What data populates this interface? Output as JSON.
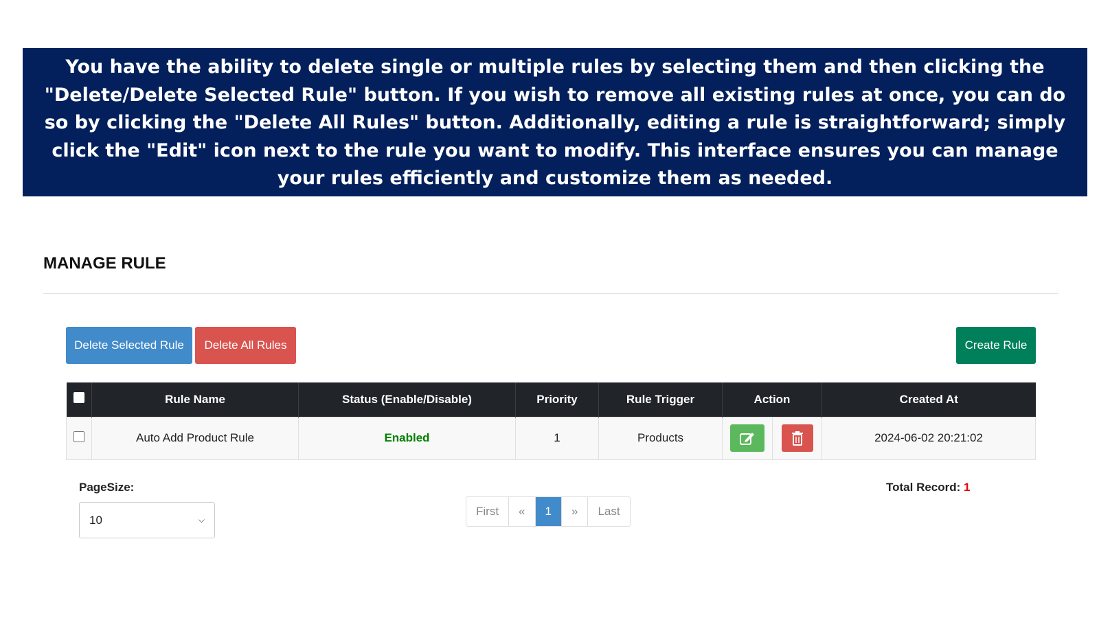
{
  "banner": {
    "text": "You have the ability to delete single or multiple rules by selecting them and then clicking the \"Delete/Delete Selected Rule\" button. If you wish to remove all existing rules at once, you can do so by clicking the \"Delete All Rules\" button. Additionally, editing a rule is straightforward; simply click the \"Edit\" icon next to the rule you want to modify. This interface ensures you can manage your rules efficiently and customize them as needed."
  },
  "page": {
    "title": "MANAGE RULE"
  },
  "toolbar": {
    "delete_selected": "Delete Selected Rule",
    "delete_all": "Delete All Rules",
    "create": "Create Rule"
  },
  "table": {
    "headers": [
      "Rule Name",
      "Status (Enable/Disable)",
      "Priority",
      "Rule Trigger",
      "Action",
      "Created At"
    ],
    "rows": [
      {
        "name": "Auto Add Product Rule",
        "status": "Enabled",
        "priority": "1",
        "trigger": "Products",
        "created": "2024-06-02 20:21:02"
      }
    ]
  },
  "footer": {
    "pagesize_label": "PageSize:",
    "pagesize_value": "10",
    "pager": [
      "First",
      "«",
      "1",
      "»",
      "Last"
    ],
    "total_label": "Total Record:",
    "total_value": "1"
  },
  "colors": {
    "banner": "#03205c",
    "primary": "#428bca",
    "danger": "#d9534f",
    "create": "#00805a",
    "edit": "#5cb85c",
    "enabled": "#008000"
  }
}
